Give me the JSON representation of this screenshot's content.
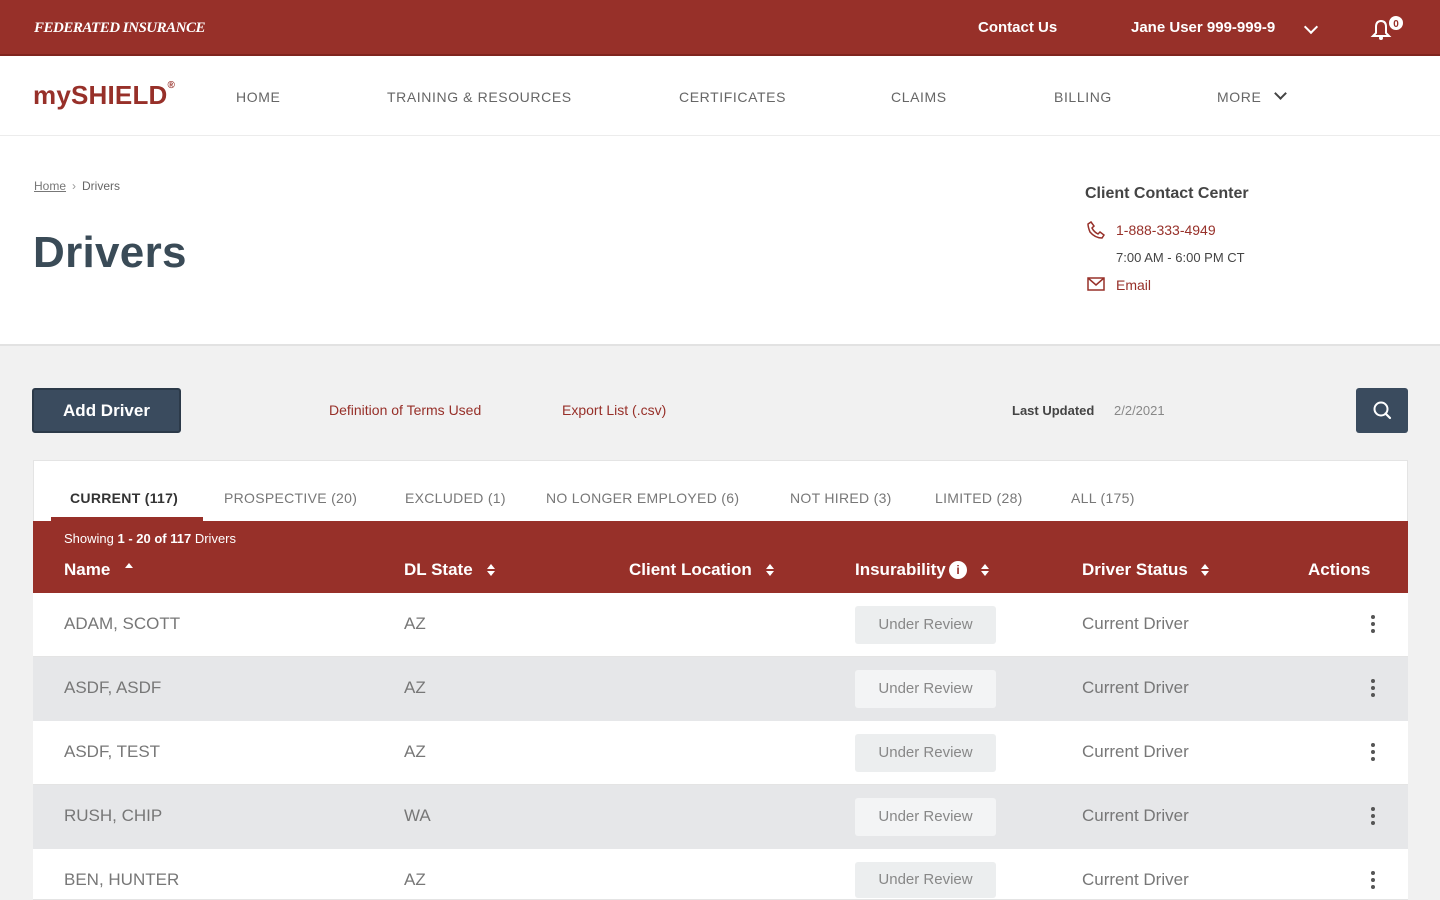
{
  "topbar": {
    "brand": "FEDERATED INSURANCE",
    "contact_label": "Contact Us",
    "user_label": "Jane User  999-999-9",
    "notification_count": "0"
  },
  "nav": {
    "logo": "mySHIELD",
    "logo_mark": "®",
    "items": [
      "HOME",
      "TRAINING & RESOURCES",
      "CERTIFICATES",
      "CLAIMS",
      "BILLING",
      "MORE"
    ]
  },
  "breadcrumb": {
    "home": "Home",
    "separator": "›",
    "current": "Drivers"
  },
  "page": {
    "title": "Drivers"
  },
  "contact": {
    "title": "Client Contact Center",
    "phone": "1-888-333-4949",
    "hours": "7:00 AM - 6:00 PM CT",
    "email_label": "Email"
  },
  "toolbar": {
    "add_driver": "Add Driver",
    "definitions_link": "Definition of Terms Used",
    "export_link": "Export List (.csv)",
    "last_updated_label": "Last Updated",
    "last_updated_value": "2/2/2021"
  },
  "tabs": [
    "CURRENT (117)",
    "PROSPECTIVE (20)",
    "EXCLUDED (1)",
    "NO LONGER EMPLOYED (6)",
    "NOT HIRED (3)",
    "LIMITED (28)",
    "ALL (175)"
  ],
  "table": {
    "showing_range": "1 - 20 of 117",
    "showing_prefix": "Showing",
    "showing_suffix": "Drivers",
    "columns": [
      "Name",
      "DL State",
      "Client Location",
      "Insurability",
      "Driver Status",
      "Actions"
    ],
    "rows": [
      {
        "name": "ADAM, SCOTT",
        "dl_state": "AZ",
        "insurability": "Under Review",
        "status": "Current Driver"
      },
      {
        "name": "ASDF, ASDF",
        "dl_state": "AZ",
        "insurability": "Under Review",
        "status": "Current Driver"
      },
      {
        "name": "ASDF, TEST",
        "dl_state": "AZ",
        "insurability": "Under Review",
        "status": "Current Driver"
      },
      {
        "name": "RUSH, CHIP",
        "dl_state": "WA",
        "insurability": "Under Review",
        "status": "Current Driver"
      },
      {
        "name": "BEN, HUNTER",
        "dl_state": "AZ",
        "insurability": "Under Review",
        "status": "Current Driver"
      }
    ]
  },
  "colors": {
    "brand_red": "#973029",
    "navy": "#3a4b5e"
  }
}
